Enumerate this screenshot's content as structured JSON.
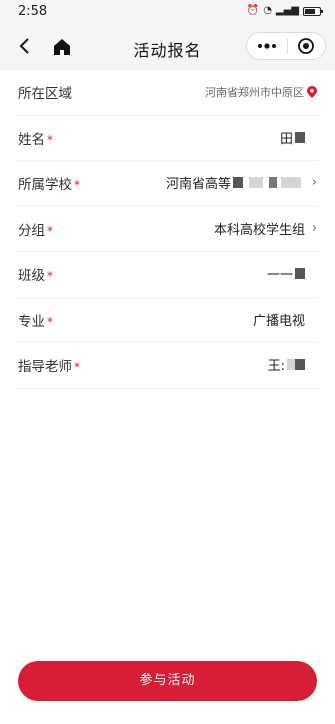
{
  "status_bar": {
    "time": "2:58"
  },
  "nav": {
    "title": "活动报名"
  },
  "form": {
    "region": {
      "label": "所在区域",
      "value": "河南省郑州市中原区"
    },
    "name": {
      "label": "姓名",
      "required": "*",
      "value": "田"
    },
    "school": {
      "label": "所属学校",
      "required": "*",
      "value": "河南省高等"
    },
    "group": {
      "label": "分组",
      "required": "*",
      "value": "本科高校学生组"
    },
    "class": {
      "label": "班级",
      "required": "*",
      "value": "一一"
    },
    "major": {
      "label": "专业",
      "required": "*",
      "value": "广播电视"
    },
    "advisor": {
      "label": "指导老师",
      "required": "*",
      "value": "王:"
    }
  },
  "submit": {
    "label": "参与活动"
  },
  "colors": {
    "accent": "#d81e35",
    "nav_background": "#f5f5f7"
  }
}
